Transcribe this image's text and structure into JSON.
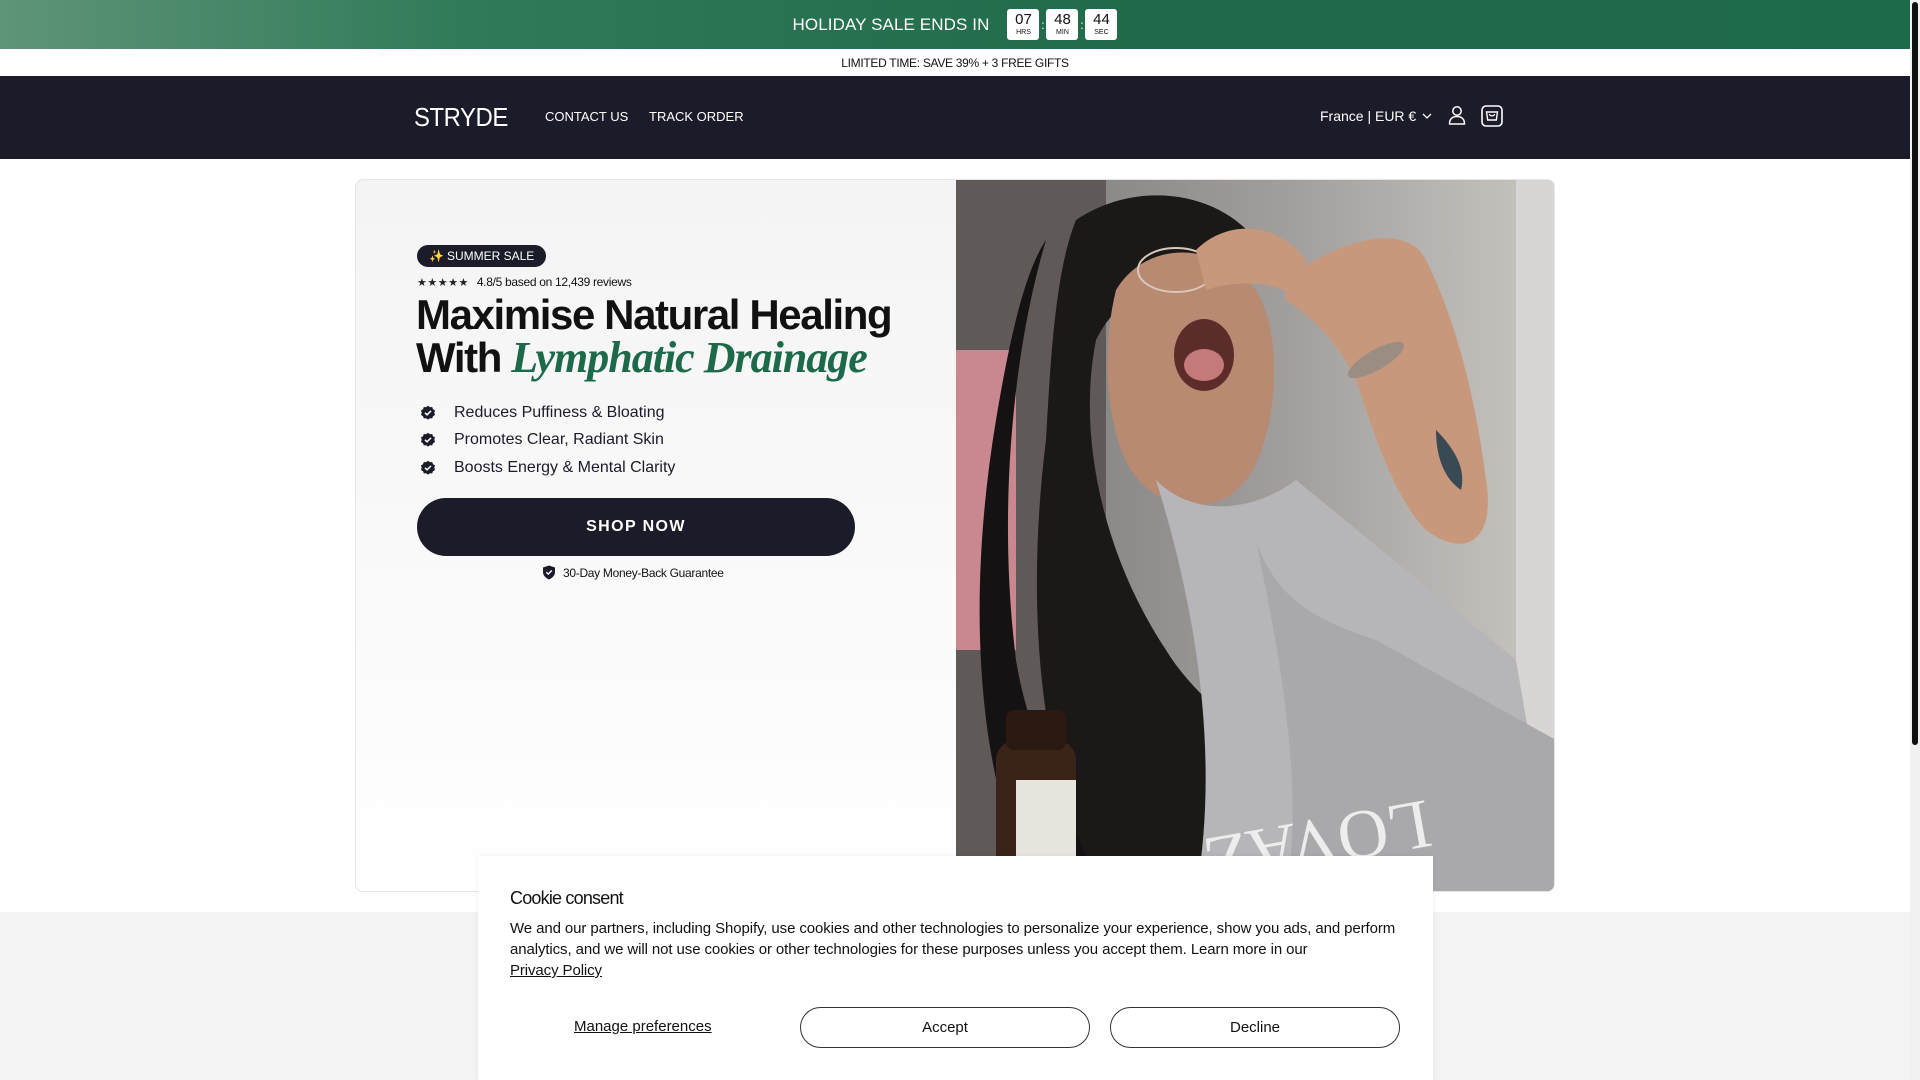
{
  "promo": {
    "title": "HOLIDAY SALE ENDS IN",
    "timer": [
      {
        "value": "07",
        "unit": "HRS"
      },
      {
        "value": "48",
        "unit": "MIN"
      },
      {
        "value": "44",
        "unit": "SEC"
      }
    ],
    "separator": ":",
    "sub_text": "LIMITED TIME: SAVE 39% + 3 FREE GIFTS"
  },
  "header": {
    "logo": "STRYDE",
    "nav": [
      "CONTACT US",
      "TRACK ORDER"
    ],
    "locale": "France | EUR €",
    "icons": [
      "chevron-down-icon",
      "account-icon",
      "cart-icon"
    ]
  },
  "hero": {
    "badge_icon": "✨",
    "badge": "SUMMER SALE",
    "stars": "★★★★★",
    "rating_text": "4.8/5 based on 12,439 reviews",
    "headline_line1": "Maximise Natural Healing",
    "headline_line2_prefix": "With",
    "headline_accent": "Lymphatic Drainage",
    "benefits": [
      "Reduces Puffiness & Bloating",
      "Promotes Clear, Radiant Skin",
      "Boosts Energy & Mental Clarity"
    ],
    "cta": "SHOP NOW",
    "guarantee": "30-Day Money-Back Guarantee",
    "accent_color": "#1d6a4b",
    "dark_color": "#1c1b2a"
  },
  "cookie": {
    "title": "Cookie consent",
    "body": "We and our partners, including Shopify, use cookies and other technologies to personalize your experience, show you ads, and perform analytics, and we will not use cookies or other technologies for these purposes unless you accept them. Learn more in our",
    "link": "Privacy Policy",
    "manage": "Manage preferences",
    "accept": "Accept",
    "decline": "Decline"
  }
}
